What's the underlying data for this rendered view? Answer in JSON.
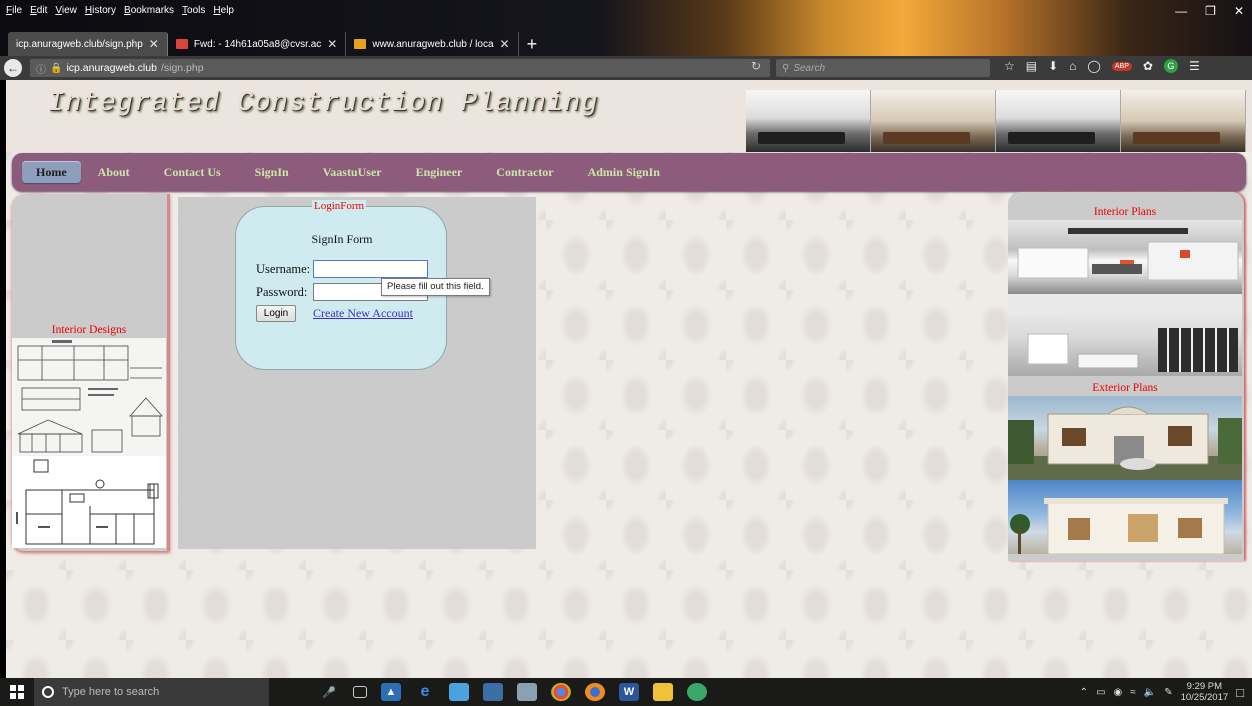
{
  "browser": {
    "menu": [
      "File",
      "Edit",
      "View",
      "History",
      "Bookmarks",
      "Tools",
      "Help"
    ],
    "tabs": [
      {
        "label": "icp.anuragweb.club/sign.php",
        "active": true
      },
      {
        "label": "Fwd: - 14h61a05a8@cvsr.ac",
        "active": false
      },
      {
        "label": "www.anuragweb.club / loca",
        "active": false
      }
    ],
    "url_host": "icp.anuragweb.club",
    "url_path": "/sign.php",
    "search_placeholder": "Search",
    "new_tab_label": "+"
  },
  "site": {
    "title": "Integrated Construction Planning",
    "nav": [
      {
        "label": "Home",
        "active": true
      },
      {
        "label": "About",
        "active": false
      },
      {
        "label": "Contact Us",
        "active": false
      },
      {
        "label": "SignIn",
        "active": false
      },
      {
        "label": "VaastuUser",
        "active": false
      },
      {
        "label": "Engineer",
        "active": false
      },
      {
        "label": "Contractor",
        "active": false
      },
      {
        "label": "Admin SignIn",
        "active": false
      }
    ],
    "left_sidebar_label": "Interior Designs",
    "right_sidebar": {
      "interior_label": "Interior Plans",
      "exterior_label": "Exterior Plans"
    }
  },
  "login": {
    "legend": "LoginForm",
    "heading": "SignIn Form",
    "username_label": "Username:",
    "password_label": "Password:",
    "username_value": "",
    "password_value": "",
    "login_button": "Login",
    "create_account_link": "Create New Account",
    "validation_message": "Please fill out this field."
  },
  "taskbar": {
    "search_placeholder": "Type here to search",
    "time": "9:29 PM",
    "date": "10/25/2017"
  },
  "colors": {
    "nav_bg": "#8d5b7b",
    "nav_text": "#c9e7a8",
    "label_red": "#ee0000",
    "form_bg": "#d0ebf0"
  }
}
